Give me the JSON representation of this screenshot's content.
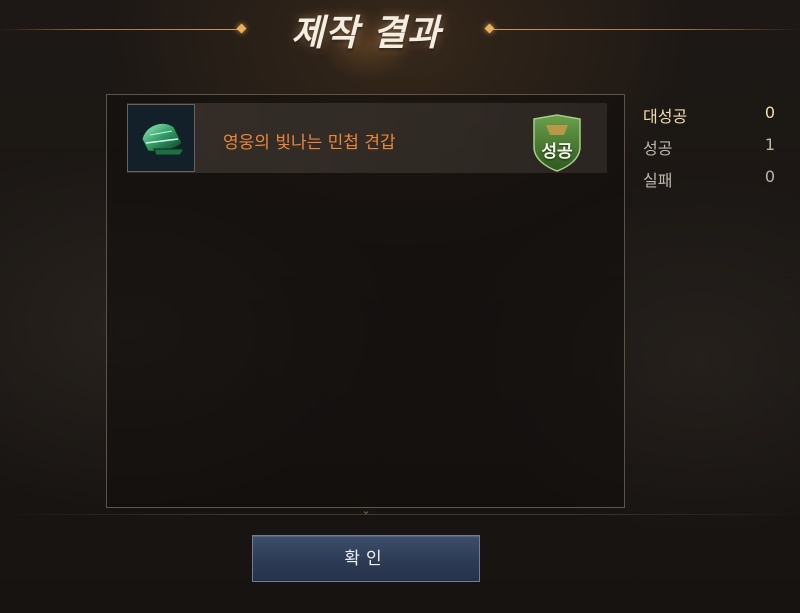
{
  "header": {
    "title": "제작 결과"
  },
  "results": [
    {
      "item_name": "영웅의 빛나는 민첩 견갑",
      "item_icon": "green-shoulder-armor-icon",
      "status_label": "성공",
      "status_color": "#3f7a2a"
    }
  ],
  "stats": {
    "great_success": {
      "label": "대성공",
      "value": "0"
    },
    "success": {
      "label": "성공",
      "value": "1"
    },
    "failure": {
      "label": "실패",
      "value": "0"
    }
  },
  "footer": {
    "confirm_label": "확인"
  },
  "colors": {
    "item_name": "#e9853c",
    "great_success_text": "#f0ddb0",
    "button": "#2d3b55"
  }
}
